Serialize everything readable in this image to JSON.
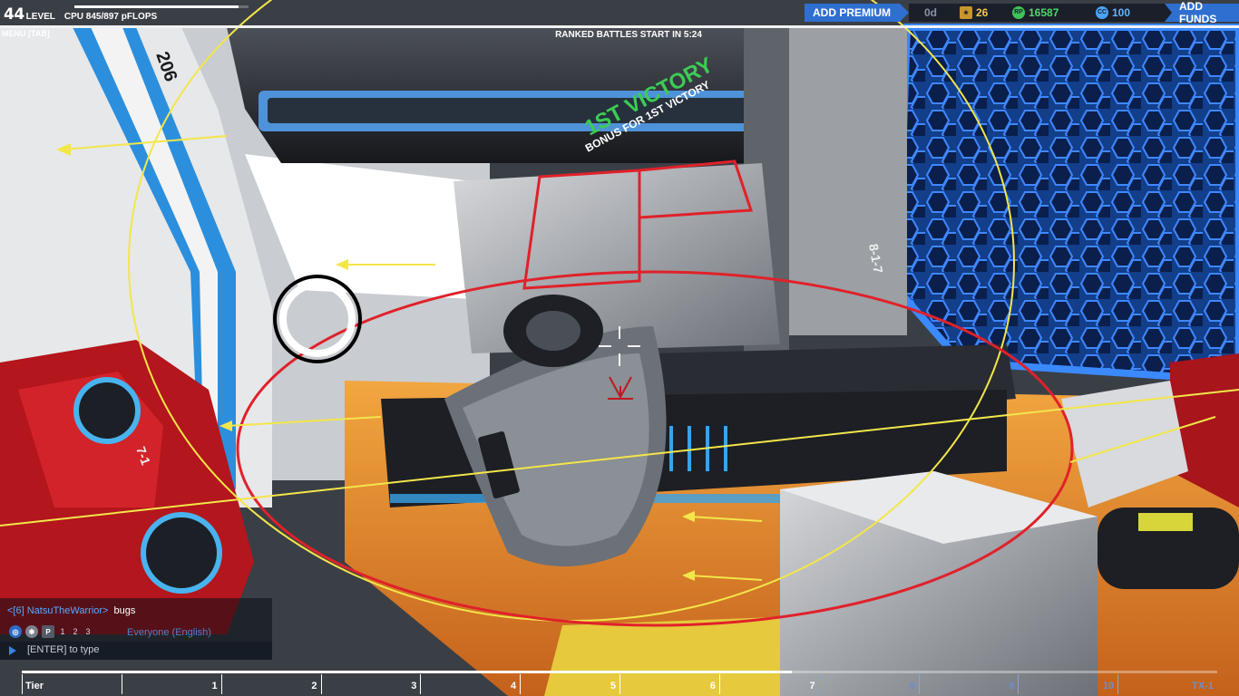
{
  "hud": {
    "level_number": "44",
    "level_label": "LEVEL",
    "cpu_text": "CPU 845/897 pFLOPS",
    "cpu_fraction": 0.942,
    "menu_label": "MENU [TAB]",
    "ranked_text": "RANKED BATTLES START IN 5:24"
  },
  "topbar": {
    "add_premium_label": "ADD PREMIUM",
    "premium_days": "0d",
    "medals": "26",
    "robits": "16587",
    "cosmetic_credits": "100",
    "add_funds_label": "ADD FUNDS",
    "colors": {
      "button": "#2f6fd0",
      "panel": "#1b1f2a",
      "robits": "#4fd66a",
      "cc": "#61b7ff",
      "medal": "#f5c54a"
    },
    "icons": {
      "medal": "medal-icon",
      "robits": "rp-coin-icon",
      "cc": "cc-coin-icon"
    }
  },
  "scene": {
    "banner_text": "1ST VICTORY",
    "banner_subtext": "BONUS FOR 1ST VICTORY",
    "armor_labels": [
      "206",
      "7-1",
      "8-1-7"
    ]
  },
  "chat": {
    "author": "<[6] NatsuTheWarrior>",
    "message": "bugs",
    "channel": "Everyone (English)",
    "input_placeholder": "[ENTER] to type",
    "tab_numbers": [
      "1",
      "2",
      "3"
    ],
    "icons": [
      "globe-icon",
      "accessibility-icon",
      "party-icon"
    ]
  },
  "tiers": {
    "labels": [
      "Tier",
      "1",
      "2",
      "3",
      "4",
      "5",
      "6",
      "7",
      "8",
      "9",
      "10",
      "TX-1"
    ],
    "current_index": 7,
    "progress_fraction": 0.644
  }
}
